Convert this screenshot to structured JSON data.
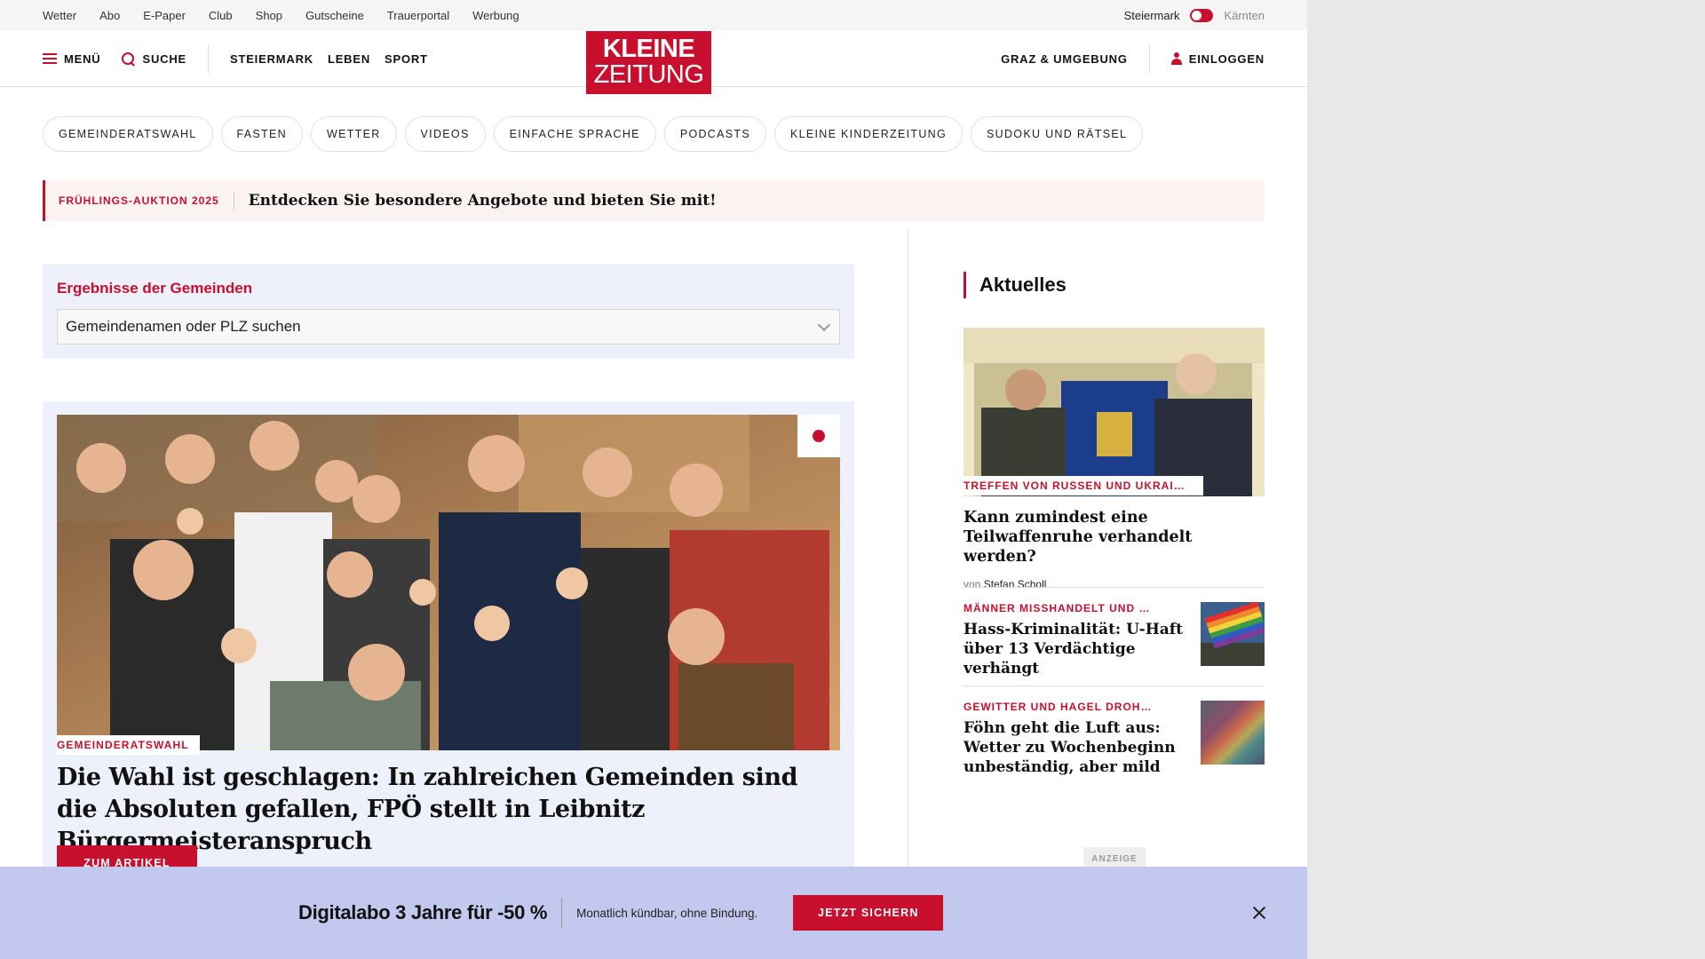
{
  "util_links": [
    "Wetter",
    "Abo",
    "E-Paper",
    "Club",
    "Shop",
    "Gutscheine",
    "Trauerportal",
    "Werbung"
  ],
  "region": {
    "active": "Steiermark",
    "inactive": "Kärnten"
  },
  "header": {
    "menu": "MENÜ",
    "search": "SUCHE",
    "nav": [
      "STEIERMARK",
      "LEBEN",
      "SPORT"
    ],
    "logo_line1": "KLEINE",
    "logo_line2": "ZEITUNG",
    "local": "GRAZ & UMGEBUNG",
    "login": "EINLOGGEN"
  },
  "pills": [
    "GEMEINDERATSWAHL",
    "FASTEN",
    "WETTER",
    "VIDEOS",
    "EINFACHE SPRACHE",
    "PODCASTS",
    "KLEINE KINDERZEITUNG",
    "SUDOKU UND RÄTSEL"
  ],
  "promo": {
    "tag": "FRÜHLINGS-AUKTION 2025",
    "text": "Entdecken Sie besondere Angebote und bieten Sie mit!"
  },
  "municipality": {
    "title": "Ergebnisse der Gemeinden",
    "placeholder": "Gemeindenamen oder PLZ suchen"
  },
  "lead_article": {
    "kicker": "GEMEINDERATSWAHL",
    "headline": "Die Wahl ist geschlagen: In zahlreichen Gemeinden sind die Absoluten gefallen, FPÖ stellt in Leibnitz Bürgermeisteranspruch",
    "button": "ZUM ARTIKEL"
  },
  "sidebar": {
    "title": "Aktuelles",
    "lead": {
      "kicker": "TREFFEN VON RUSSEN UND UKRAINERN",
      "title": "Kann zumindest eine Teilwaffenruhe verhandelt werden?",
      "author_prefix": "von",
      "author": "Stefan Scholl"
    },
    "items": [
      {
        "kicker": "MÄNNER MISSHANDELT UND ERPRESST",
        "title": "Hass-Kriminalität: U-Haft über 13 Verdächtige verhängt"
      },
      {
        "kicker": "GEWITTER UND HAGEL DROHEN",
        "title": "Föhn geht die Luft aus: Wetter zu Wochenbeginn unbeständig, aber mild"
      }
    ],
    "ad_label": "ANZEIGE"
  },
  "sticky": {
    "title": "Digitalabo 3 Jahre für -50 %",
    "subtitle": "Monatlich kündbar, ohne Bindung.",
    "button": "JETZT SICHERN"
  }
}
